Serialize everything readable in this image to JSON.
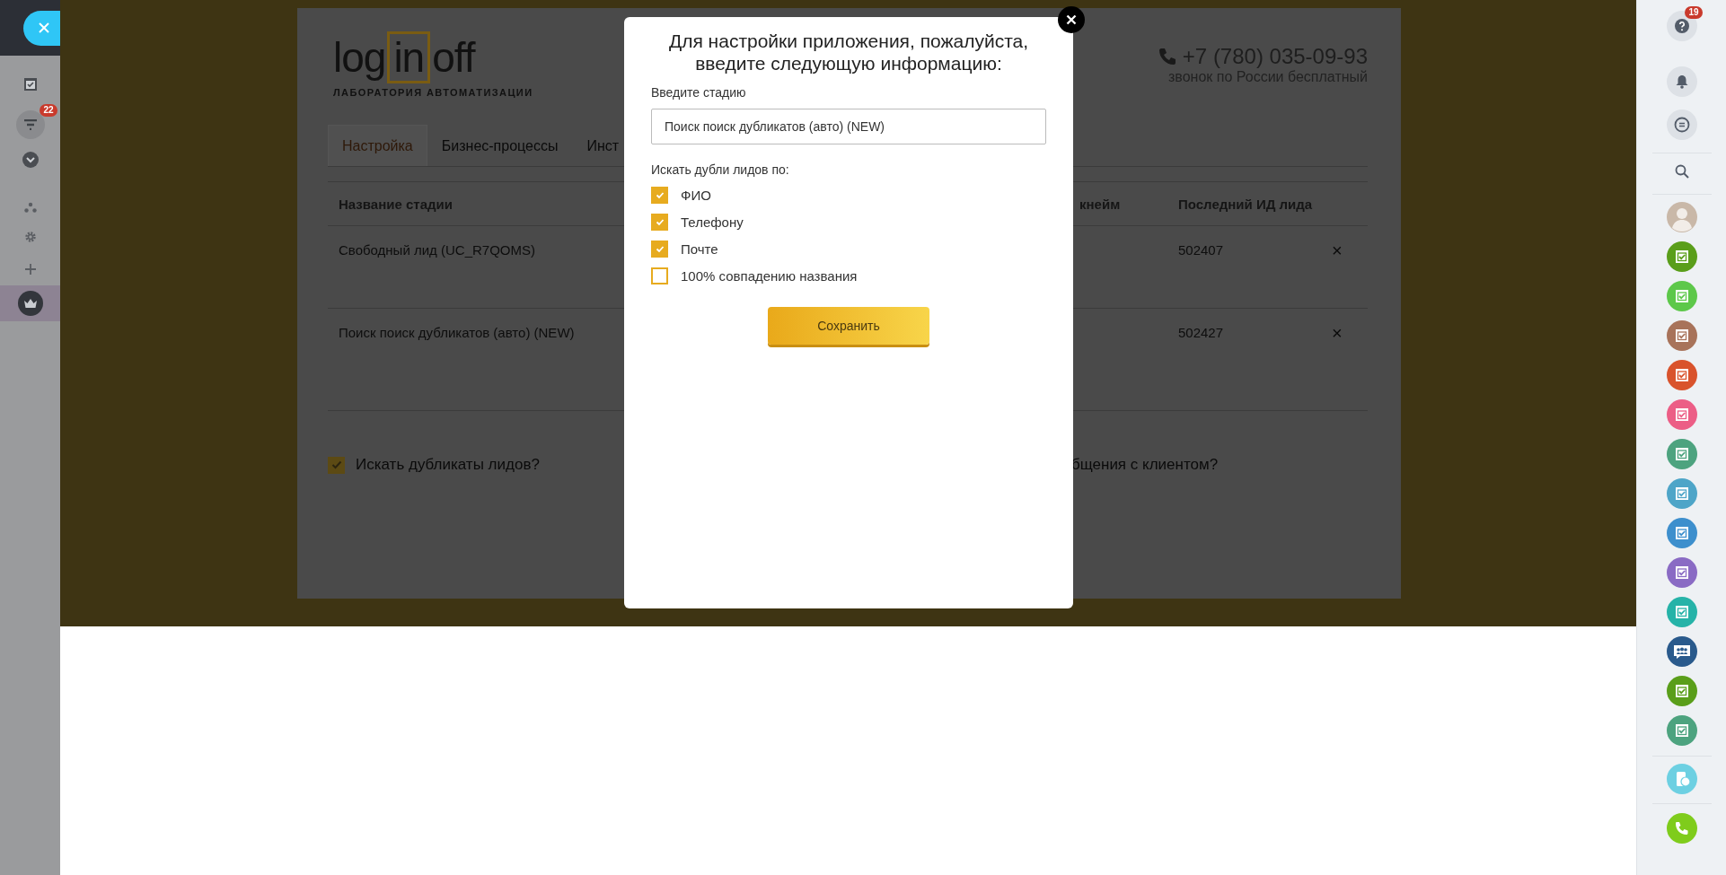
{
  "left_sidebar": {
    "items": [
      {
        "kind": "tasks",
        "selected": false
      },
      {
        "kind": "filter",
        "selected": false,
        "badge": "22"
      },
      {
        "kind": "more",
        "selected": false
      },
      {
        "kind": "structure",
        "selected": false
      },
      {
        "kind": "settings",
        "selected": false
      },
      {
        "kind": "add",
        "selected": false
      },
      {
        "kind": "crown",
        "selected": true
      }
    ]
  },
  "app": {
    "logo": {
      "parts": [
        "log",
        "in",
        "off"
      ],
      "tagline": "ЛАБОРАТОРИЯ АВТОМАТИЗАЦИИ"
    },
    "phone": "+7 (780) 035-09-93",
    "phone_note": "звонок по России бесплатный",
    "tabs": [
      {
        "label": "Настройка",
        "selected": true
      },
      {
        "label": "Бизнес-процессы",
        "selected": false
      },
      {
        "label": "Инст",
        "selected": false
      }
    ],
    "table": {
      "columns": [
        "Название стадии",
        "кнейм",
        "Последний ИД лида"
      ],
      "rows": [
        {
          "cells": [
            "Свободный лид (UC_R7QOMS)",
            "",
            "502407"
          ],
          "remove": "×"
        },
        {
          "cells": [
            "Поиск поиск дубликатов (авто) (NEW)",
            "",
            "502427"
          ],
          "remove": "×"
        }
      ]
    },
    "options": [
      {
        "label": "Искать дубликаты лидов?",
        "checked": true
      },
      {
        "label": "бщения с клиентом?"
      }
    ]
  },
  "modal": {
    "title": "Для настройки приложения, пожалуйста, введите следующую информацию:",
    "stage_label": "Введите стадию",
    "stage_value": "Поиск поиск дубликатов (авто) (NEW)",
    "criteria_label": "Искать дубли лидов по:",
    "criteria": [
      {
        "label": "ФИО",
        "checked": true
      },
      {
        "label": "Телефону",
        "checked": true
      },
      {
        "label": "Почте",
        "checked": true
      },
      {
        "label": "100% совпадению названия",
        "checked": false
      }
    ],
    "save": "Сохранить"
  },
  "right_sidebar": {
    "help_badge": "19",
    "chats": [
      {
        "kind": "avatar"
      },
      {
        "kind": "task",
        "color": "#5a9e1a"
      },
      {
        "kind": "task",
        "color": "#5dc84a"
      },
      {
        "kind": "task",
        "color": "#a8735a"
      },
      {
        "kind": "task",
        "color": "#d9532c"
      },
      {
        "kind": "task",
        "color": "#ec5e86"
      },
      {
        "kind": "task",
        "color": "#4da37f"
      },
      {
        "kind": "task",
        "color": "#4ea5c8"
      },
      {
        "kind": "task",
        "color": "#3d8fcd"
      },
      {
        "kind": "task",
        "color": "#8a6bc4"
      },
      {
        "kind": "task",
        "color": "#26b3a8"
      },
      {
        "kind": "group",
        "color": "#2a5a8c"
      },
      {
        "kind": "task",
        "color": "#5a9e1a"
      },
      {
        "kind": "task",
        "color": "#4da37f"
      }
    ]
  }
}
